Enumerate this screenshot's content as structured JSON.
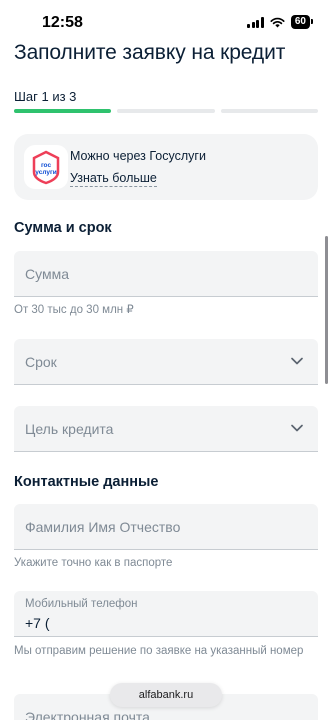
{
  "status": {
    "time": "12:58",
    "battery": "60"
  },
  "page": {
    "title": "Заполните заявку на кредит",
    "step": "Шаг 1 из 3"
  },
  "gosuslugi": {
    "logo_text_1": "гос",
    "logo_text_2": "услуги",
    "title": "Можно через Госуслуги",
    "link": "Узнать больше"
  },
  "sections": {
    "amount_term": "Сумма и срок",
    "contacts": "Контактные данные"
  },
  "fields": {
    "amount": {
      "placeholder": "Сумма",
      "hint": "От 30 тыс до 30 млн ₽"
    },
    "term": {
      "placeholder": "Срок"
    },
    "purpose": {
      "placeholder": "Цель кредита"
    },
    "fullname": {
      "placeholder": "Фамилия Имя Отчество",
      "hint": "Укажите точно как в паспорте"
    },
    "phone": {
      "label": "Мобильный телефон",
      "value": "+7 (",
      "hint": "Мы отправим решение по заявке на указанный номер"
    },
    "email": {
      "placeholder": "Электронная почта"
    }
  },
  "browser": {
    "url": "alfabank.ru"
  },
  "colors": {
    "progress_active": "#2fc26e",
    "gos_blue": "#0d4cd3",
    "gos_red": "#ee3f58",
    "field_bg": "#f3f4f5"
  }
}
